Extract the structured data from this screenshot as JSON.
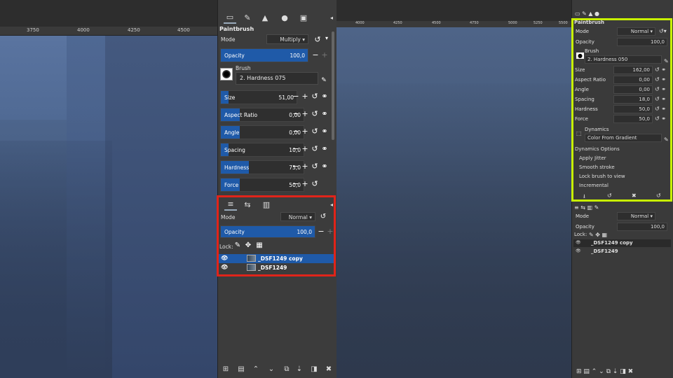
{
  "left_ruler": {
    "ticks": [
      "3750",
      "4000",
      "4250",
      "4500"
    ]
  },
  "right_ruler": {
    "ticks": [
      "4000",
      "4250",
      "4500",
      "4750",
      "5000",
      "5250",
      "5500"
    ]
  },
  "left_dock": {
    "title": "Paintbrush",
    "mode_label": "Mode",
    "mode_value": "Multiply",
    "opacity": {
      "label": "Opacity",
      "value": "100,0",
      "fill": 1.0
    },
    "brush_label": "Brush",
    "brush_name": "2. Hardness 075",
    "sliders": [
      {
        "label": "Size",
        "value": "51,00",
        "fill": 0.22
      },
      {
        "label": "Aspect Ratio",
        "value": "0,00",
        "fill": 0.5
      },
      {
        "label": "Angle",
        "value": "0,00",
        "fill": 0.5
      },
      {
        "label": "Spacing",
        "value": "10,0",
        "fill": 0.2
      },
      {
        "label": "Hardness",
        "value": "75,0",
        "fill": 0.75
      },
      {
        "label": "Force",
        "value": "50,0",
        "fill": 0.5
      }
    ],
    "layers": {
      "mode_label": "Mode",
      "mode_value": "Normal",
      "opacity_label": "Opacity",
      "opacity_value": "100,0",
      "lock_label": "Lock:",
      "items": [
        {
          "name": "_DSF1249 copy",
          "selected": true
        },
        {
          "name": "_DSF1249",
          "selected": false
        }
      ]
    }
  },
  "right_dock": {
    "title": "Paintbrush",
    "mode_label": "Mode",
    "mode_value": "Normal",
    "opacity_label": "Opacity",
    "opacity_value": "100,0",
    "brush_label": "Brush",
    "brush_name": "2. Hardness 050",
    "fields": [
      {
        "label": "Size",
        "value": "162,00"
      },
      {
        "label": "Aspect Ratio",
        "value": "0,00"
      },
      {
        "label": "Angle",
        "value": "0,00"
      },
      {
        "label": "Spacing",
        "value": "18,0"
      },
      {
        "label": "Hardness",
        "value": "50,0"
      },
      {
        "label": "Force",
        "value": "50,0"
      }
    ],
    "dynamics_label": "Dynamics",
    "dynamics_value": "Color From Gradient",
    "options": [
      "Dynamics Options",
      "Apply Jitter",
      "Smooth stroke",
      "Lock brush to view",
      "Incremental"
    ],
    "layers": {
      "mode_label": "Mode",
      "mode_value": "Normal",
      "opacity_label": "Opacity",
      "opacity_value": "100,0",
      "lock_label": "Lock:",
      "items": [
        {
          "name": "_DSF1249 copy"
        },
        {
          "name": "_DSF1249"
        }
      ]
    }
  },
  "colors": {
    "accent": "#1f5aa8",
    "highlight_red": "#e0241a",
    "highlight_green": "#c8f000"
  }
}
